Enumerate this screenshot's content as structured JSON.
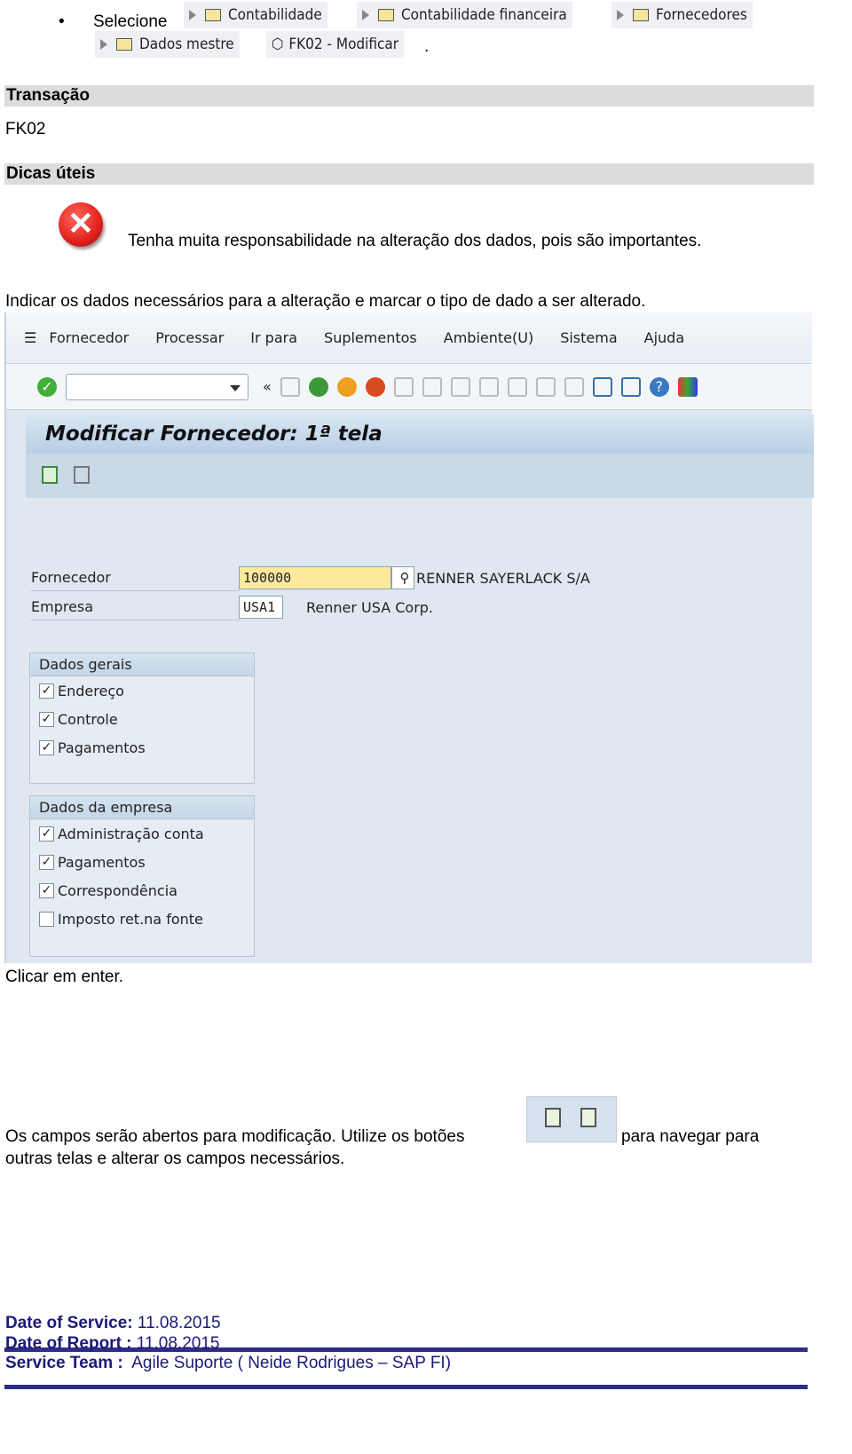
{
  "intro": {
    "bullet": "•",
    "select_label": "Selecione",
    "path": [
      "Contabilidade",
      "Contabilidade financeira",
      "Fornecedores",
      "Dados mestre"
    ],
    "transaction": "FK02 - Modificar",
    "trailing": "."
  },
  "sections": {
    "transaction_header": "Transação",
    "transaction_value": "FK02",
    "tips_header": "Dicas úteis"
  },
  "warning": {
    "icon": "error-x-icon",
    "text": "Tenha muita responsabilidade na alteração dos dados, pois são importantes."
  },
  "instruction1": "Indicar os dados necessários para a alteração e marcar o tipo de dado a ser alterado.",
  "sap": {
    "menu": [
      "Fornecedor",
      "Processar",
      "Ir para",
      "Suplementos",
      "Ambiente(U)",
      "Sistema",
      "Ajuda"
    ],
    "command_field": "",
    "title": "Modificar Fornecedor: 1ª tela",
    "fields": {
      "vendor_label": "Fornecedor",
      "vendor_value": "100000",
      "vendor_name": "RENNER SAYERLACK S/A",
      "company_label": "Empresa",
      "company_value": "USA1",
      "company_name": "Renner USA Corp."
    },
    "general": {
      "title": "Dados gerais",
      "items": [
        {
          "label": "Endereço",
          "checked": true
        },
        {
          "label": "Controle",
          "checked": true
        },
        {
          "label": "Pagamentos",
          "checked": true
        }
      ]
    },
    "company_data": {
      "title": "Dados da empresa",
      "items": [
        {
          "label": "Administração conta",
          "checked": true
        },
        {
          "label": "Pagamentos",
          "checked": true
        },
        {
          "label": "Correspondência",
          "checked": true
        },
        {
          "label": "Imposto ret.na fonte",
          "checked": false
        }
      ]
    }
  },
  "instruction2": "Clicar em enter.",
  "instruction3a": "Os campos serão abertos para modificação. Utilize os botões",
  "instruction3b": "para navegar para",
  "instruction3c": "outras telas e alterar os campos necessários.",
  "footer": {
    "service_label": "Date of Service:",
    "service_date": "11.08.2015",
    "report_label": "Date of Report :",
    "report_date": "11.08.2015",
    "team_label": "Service Team :",
    "team_value": "Agile Suporte ( Neide Rodrigues – SAP FI)"
  },
  "colors": {
    "footer_text": "#1a1a7a",
    "footer_rule": "#2e2e86",
    "error_red": "#e0201c",
    "input_highlight": "#fdeb9c"
  }
}
